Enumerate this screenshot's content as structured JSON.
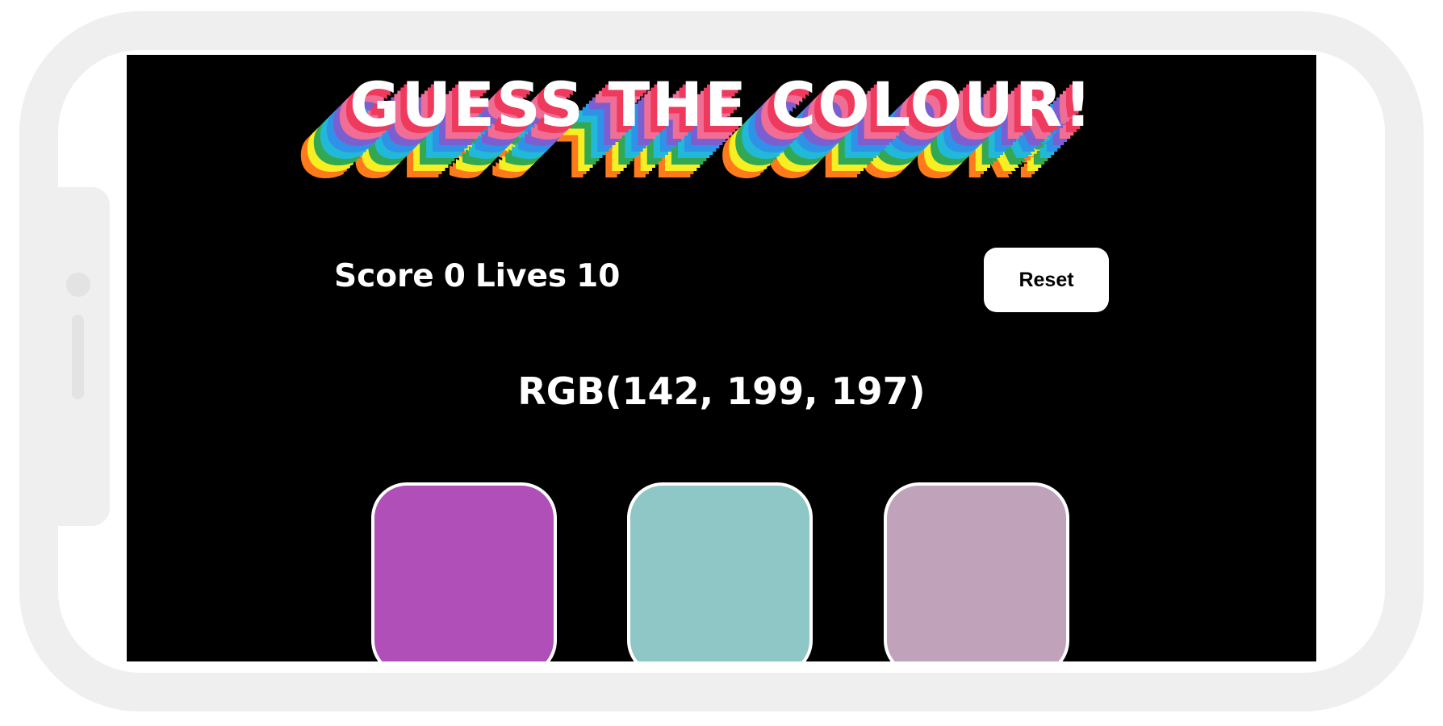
{
  "title": "GUESS THE COLOUR!",
  "status": {
    "score_label": "Score",
    "score_value": "0",
    "lives_label": "Lives",
    "lives_value": "10"
  },
  "reset_label": "Reset",
  "target_rgb": "RGB(142, 199, 197)",
  "swatches": [
    {
      "color": "#b14fb9"
    },
    {
      "color": "#8ec7c5"
    },
    {
      "color": "#c0a2ba"
    }
  ],
  "title_shadow_colors": [
    "#ef3a5d",
    "#f06e96",
    "#7b5fd0",
    "#2e93e8",
    "#22b8d8",
    "#33a852",
    "#f7ef22",
    "#ff7a1a"
  ]
}
